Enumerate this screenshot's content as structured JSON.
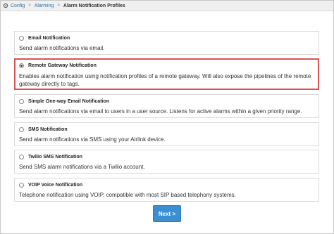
{
  "breadcrumb": {
    "icon": "gear-icon",
    "items": [
      "Config",
      "Alarming",
      "Alarm Notification Profiles"
    ],
    "separator": ">"
  },
  "options": [
    {
      "title": "Email Notification",
      "description": "Send alarm notifications via email.",
      "selected": false
    },
    {
      "title": "Remote Gateway Notification",
      "description": "Enables alarm notification using notification profiles of a remote gateway. Will also expose the pipelines of the remote gateway directly to tags.",
      "selected": true
    },
    {
      "title": "Simple One-way Email Notification",
      "description": "Send alarm notifications via email to users in a user source. Listens for active alarms within a given priority range.",
      "selected": false
    },
    {
      "title": "SMS Notification",
      "description": "Send alarm notifications via SMS using your Airlink device.",
      "selected": false
    },
    {
      "title": "Twilio SMS Notification",
      "description": "Send SMS alarm notifications via a Twilio account.",
      "selected": false
    },
    {
      "title": "VOIP Voice Notification",
      "description": "Telephone notification using VOIP, compatible with most SIP based telephony systems.",
      "selected": false
    }
  ],
  "next_button": {
    "label": "Next >"
  },
  "colors": {
    "accent": "#3a8fd3",
    "selection_border": "#d9534f"
  }
}
